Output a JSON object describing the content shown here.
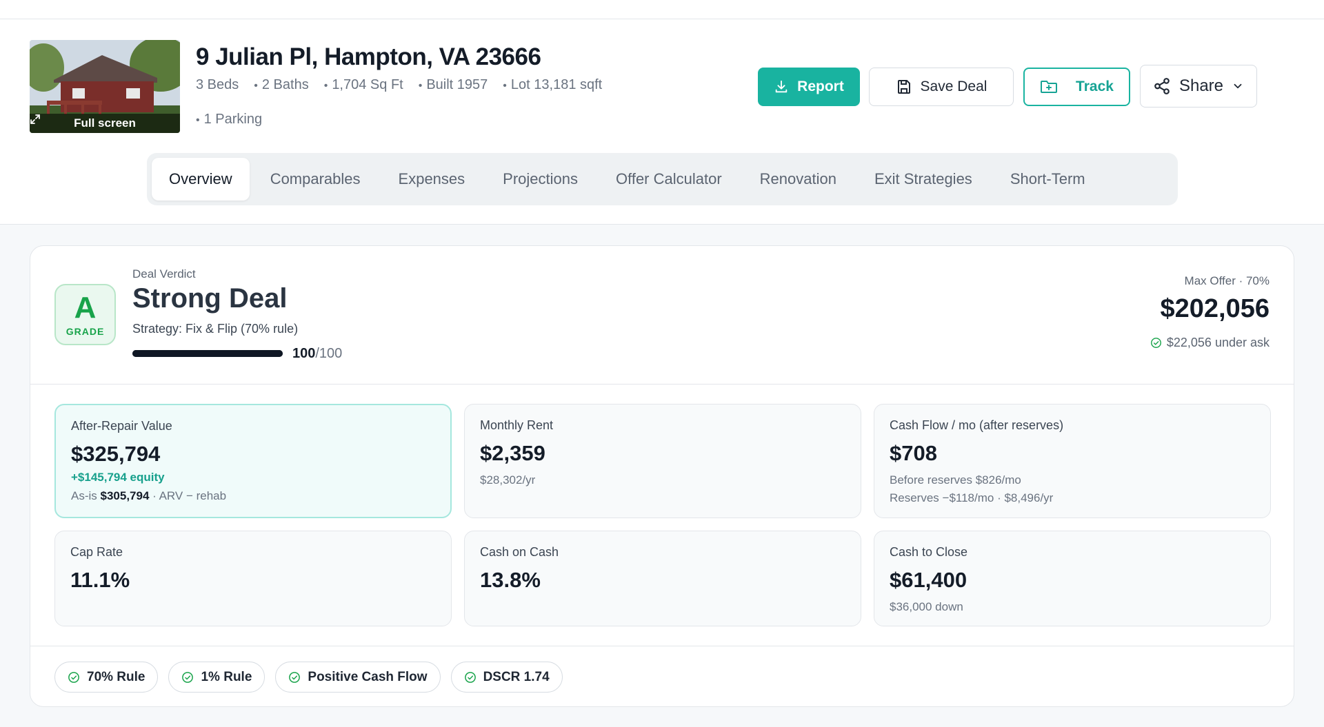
{
  "colors": {
    "accent": "#19b3a0",
    "grade_green": "#18a34a",
    "text": "#141c28",
    "muted": "#6a7380"
  },
  "property": {
    "photo_action": "Full screen",
    "address": "9 Julian Pl, Hampton, VA 23666",
    "specs": [
      "3 Beds",
      "2 Baths",
      "1,704 Sq Ft",
      "Built 1957",
      "Lot 13,181 sqft",
      "1 Parking"
    ]
  },
  "actions": {
    "report": "Report",
    "save": "Save Deal",
    "track": "Track",
    "share": "Share"
  },
  "tabs": [
    "Overview",
    "Comparables",
    "Expenses",
    "Projections",
    "Offer Calculator",
    "Renovation",
    "Exit Strategies",
    "Short-Term"
  ],
  "active_tab": "Overview",
  "verdict": {
    "grade": "A",
    "grade_label": "GRADE",
    "label": "Deal Verdict",
    "title": "Strong Deal",
    "strategy": "Strategy: Fix & Flip (70% rule)",
    "score": 100,
    "score_max": 100,
    "score_value": "100",
    "score_max_text": "/100"
  },
  "max_offer": {
    "label": "Max Offer · 70%",
    "value": "$202,056",
    "under_ask": "$22,056 under ask"
  },
  "metrics": {
    "arv": {
      "label": "After-Repair Value",
      "value": "$325,794",
      "equity": "+$145,794 equity",
      "as_is_prefix": "As-is ",
      "as_is_value": "$305,794",
      "as_is_suffix": " · ARV − rehab"
    },
    "rent": {
      "label": "Monthly Rent",
      "value": "$2,359",
      "sub": "$28,302/yr"
    },
    "cashflow": {
      "label": "Cash Flow / mo (after reserves)",
      "value": "$708",
      "sub1": "Before reserves $826/mo",
      "sub2": "Reserves −$118/mo · $8,496/yr"
    },
    "cap_rate": {
      "label": "Cap Rate",
      "value": "11.1%"
    },
    "coc": {
      "label": "Cash on Cash",
      "value": "13.8%"
    },
    "cash_to_close": {
      "label": "Cash to Close",
      "value": "$61,400",
      "sub": "$36,000 down"
    }
  },
  "checks": [
    "70% Rule",
    "1% Rule",
    "Positive Cash Flow",
    "DSCR 1.74"
  ]
}
